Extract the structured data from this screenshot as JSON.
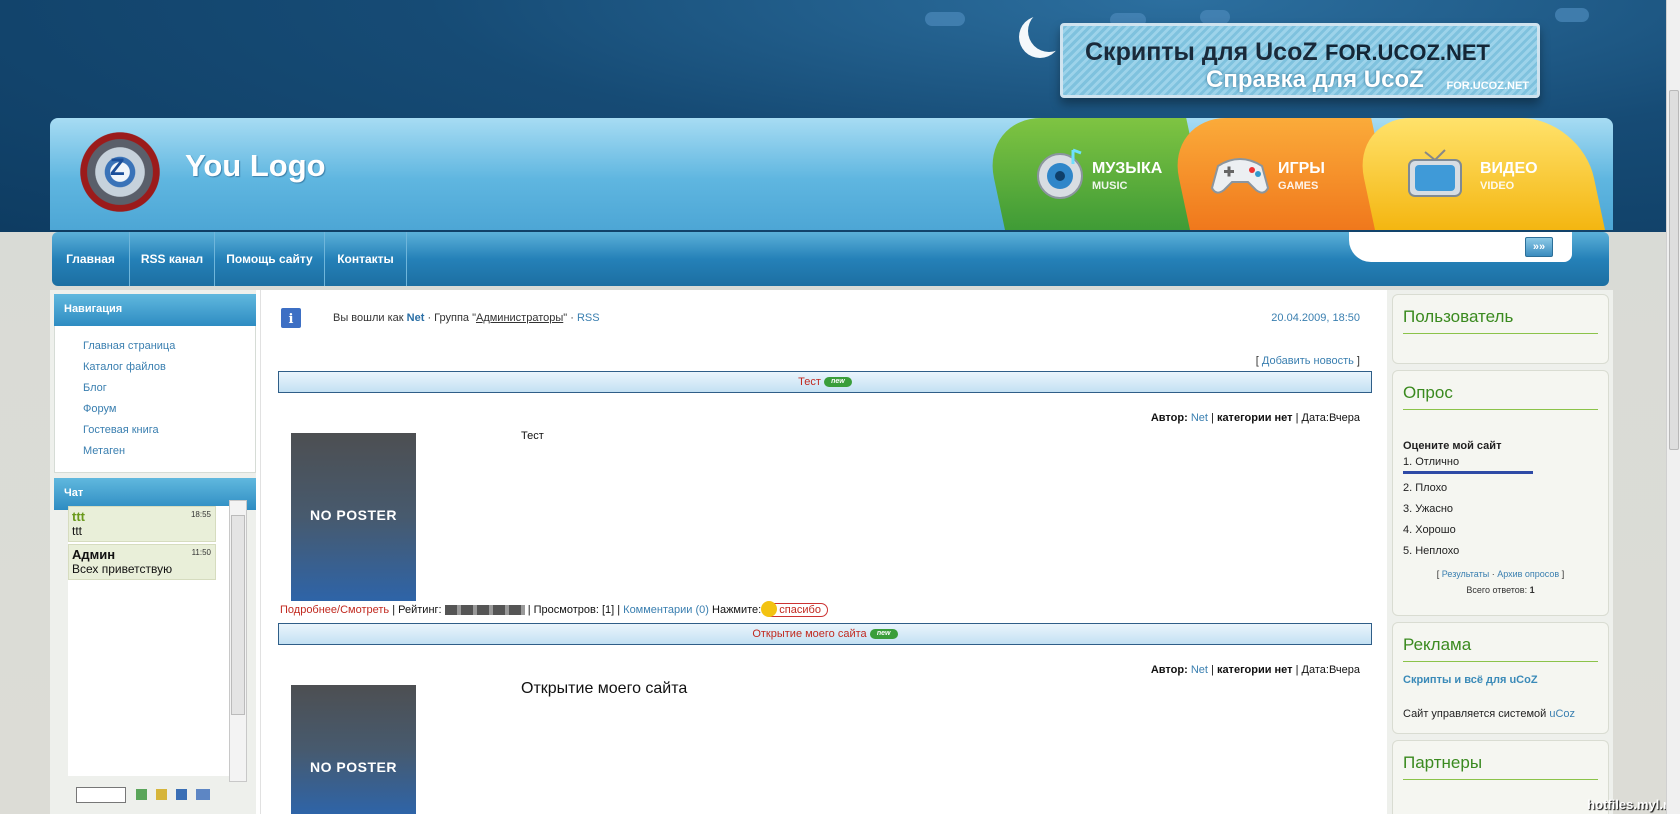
{
  "banner": {
    "line1": "Скрипты для UcoZ",
    "line2": "FOR.UCOZ.NET",
    "line3": "Справка для UcoZ",
    "line4": "FOR.UCOZ.NET"
  },
  "header": {
    "logo_text": "You Logo",
    "logo_letter": "Z",
    "categories": [
      {
        "title": "МУЗЫКА",
        "subtitle": "MUSIC"
      },
      {
        "title": "ИГРЫ",
        "subtitle": "GAMES"
      },
      {
        "title": "ВИДЕО",
        "subtitle": "VIDEO"
      }
    ]
  },
  "nav": {
    "items": [
      "Главная",
      "RSS канал",
      "Помощь сайту",
      "Контакты"
    ],
    "search_button": "»»"
  },
  "sidebar": {
    "nav_title": "Навигация",
    "nav_items": [
      "Главная страница",
      "Каталог файлов",
      "Блог",
      "Форум",
      "Гостевая книга",
      "Метаген"
    ],
    "chat_title": "Чат",
    "chat_messages": [
      {
        "name": "ttt",
        "time": "18:55",
        "text": "ttt"
      },
      {
        "name": "Админ",
        "time": "11:50",
        "text": "Всех приветствую"
      }
    ]
  },
  "welcome": {
    "prefix": "Вы вошли как",
    "user": "Net",
    "group_text": "· Группа \"",
    "group": "Администраторы",
    "suffix": "\" ·",
    "rss": "RSS",
    "date": "20.04.2009, 18:50"
  },
  "add_news": "Добавить новость",
  "news": [
    {
      "title": "Тест",
      "badge": "new",
      "author_label": "Автор:",
      "author": "Net",
      "category": "категории нет",
      "date_label": "Дата:",
      "date": "Вчера",
      "body": "Тест",
      "poster": "NO POSTER"
    },
    {
      "title": "Открытие моего сайта",
      "badge": "new",
      "author_label": "Автор:",
      "author": "Net",
      "category": "категории нет",
      "date_label": "Дата:",
      "date": "Вчера",
      "body": "Открытие моего сайта",
      "poster": "NO POSTER"
    }
  ],
  "footer_line": {
    "more": "Подробнее/Смотреть",
    "rating_label": "| Рейтинг:",
    "views": "| Просмотров: [1] |",
    "comments": "Комментарии (0)",
    "press": "Нажмите:",
    "thanks": "спасибо"
  },
  "right": {
    "user_title": "Пользователь",
    "poll_title": "Опрос",
    "poll_question": "Оцените мой сайт",
    "poll_options": [
      "1. Отлично",
      "2. Плохо",
      "3. Ужасно",
      "4. Хорошо",
      "5. Неплохо"
    ],
    "poll_results": "Результаты",
    "poll_archive": "Архив опросов",
    "poll_total_label": "Всего ответов:",
    "poll_total": "1",
    "ads_title": "Реклама",
    "ads_link": "Скрипты и всё для uCoZ",
    "ads_text": "Сайт управляется системой",
    "ads_system": "uCoz",
    "partners_title": "Партнеры"
  },
  "watermark": "hotfiles.myl.ru",
  "colors": {
    "accent": "#2e8cc2",
    "link": "#3a7fb0",
    "title_red": "#c1291f",
    "green": "#3a8a1f"
  }
}
